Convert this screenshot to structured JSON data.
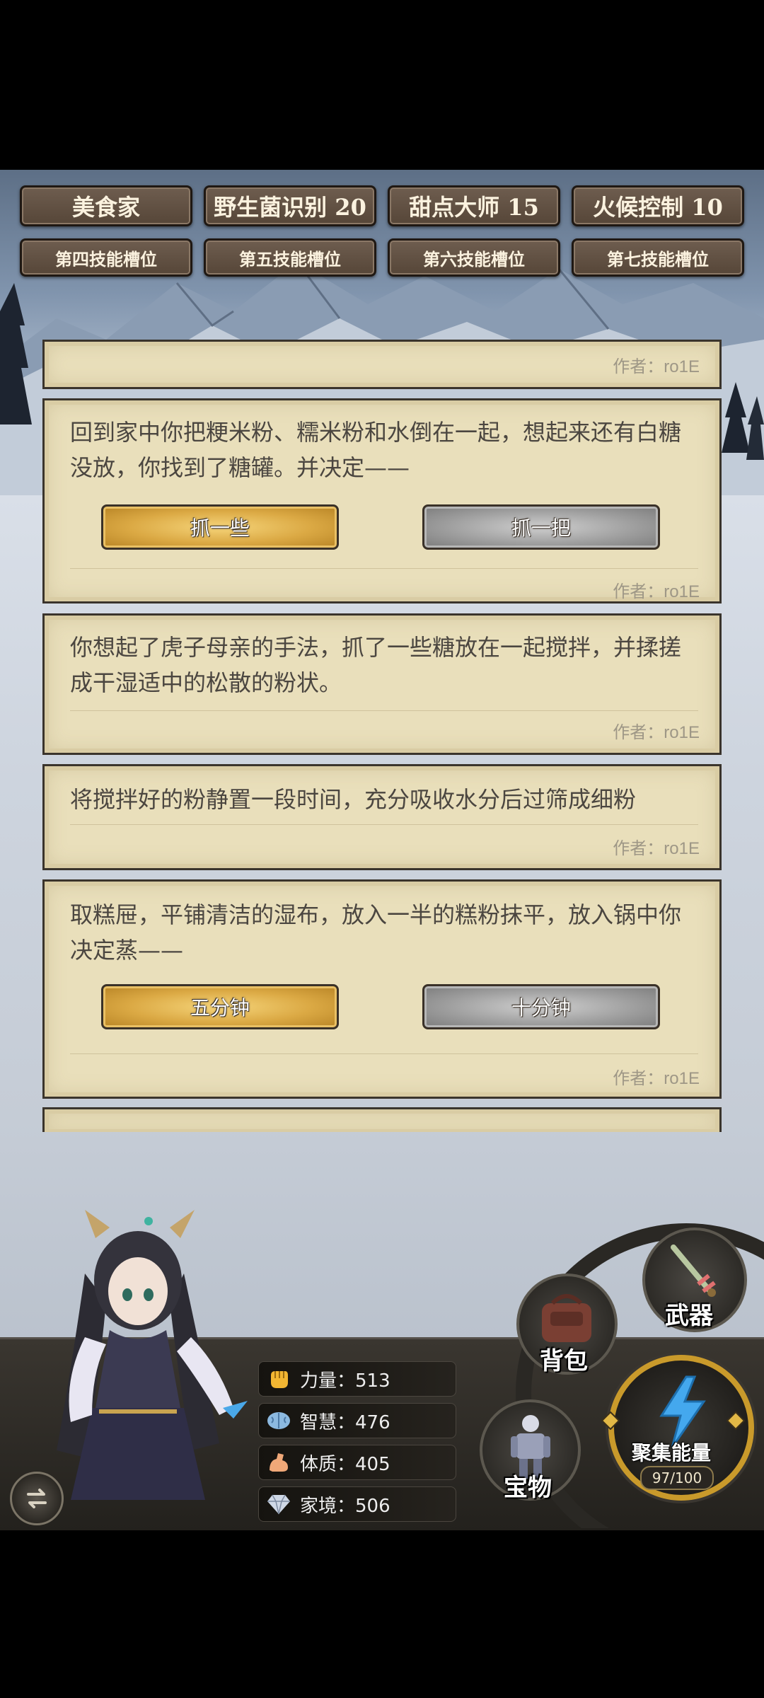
{
  "skills": {
    "row1": [
      "美食家",
      "野生菌识别 20",
      "甜点大师 15",
      "火候控制 10"
    ],
    "row2": [
      "第四技能槽位",
      "第五技能槽位",
      "第六技能槽位",
      "第七技能槽位"
    ]
  },
  "story": {
    "author": "作者：ro1E",
    "cards": [
      {
        "text": "回到家中你把粳米粉、糯米粉和水倒在一起，想起来还有白糖没放，你找到了糖罐。并决定——",
        "choices": [
          "抓一些",
          "抓一把"
        ]
      },
      {
        "text": "你想起了虎子母亲的手法，抓了一些糖放在一起搅拌，并揉搓成干湿适中的松散的粉状。"
      },
      {
        "text": "将搅拌好的粉静置一段时间，充分吸收水分后过筛成细粉"
      },
      {
        "text": "取糕屉，平铺清洁的湿布，放入一半的糕粉抹平，放入锅中你决定蒸——",
        "choices": [
          "五分钟",
          "十分钟"
        ]
      }
    ]
  },
  "stats": [
    {
      "label": "力量：513",
      "icon": "fist-icon"
    },
    {
      "label": "智慧：476",
      "icon": "brain-icon"
    },
    {
      "label": "体质：405",
      "icon": "muscle-icon"
    },
    {
      "label": "家境：506",
      "icon": "diamond-icon"
    }
  ],
  "menu": {
    "weapon": "武器",
    "backpack": "背包",
    "treasure": "宝物",
    "energy": "聚集能量",
    "energy_count": "97/100",
    "energy_value": 97,
    "energy_max": 100
  }
}
